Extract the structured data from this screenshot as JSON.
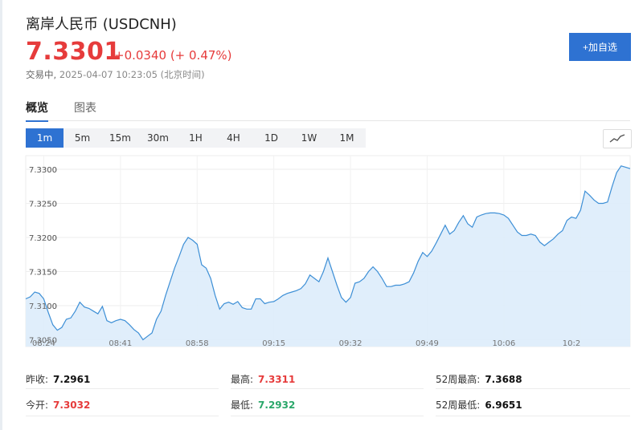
{
  "header": {
    "title": "离岸人民币 (USDCNH)",
    "price": "7.3301",
    "change": "+0.0340 (+ 0.47%)",
    "status": "交易中",
    "timestamp": "2025-04-07 10:23:05 (北京时间)",
    "add_button": "+加自选"
  },
  "tabs": [
    "概览",
    "图表"
  ],
  "periods": [
    "1m",
    "5m",
    "15m",
    "30m",
    "1H",
    "4H",
    "1D",
    "1W",
    "1M"
  ],
  "active_period": "1m",
  "colors": {
    "up": "#e63b3b",
    "down": "#2aa76a",
    "accent": "#2e72d2",
    "line": "#3d8fd6",
    "fill": "#ddecfb"
  },
  "stats": {
    "prev_close": {
      "label": "昨收:",
      "value": "7.2961"
    },
    "open": {
      "label": "今开:",
      "value": "7.3032"
    },
    "high": {
      "label": "最高:",
      "value": "7.3311"
    },
    "low": {
      "label": "最低:",
      "value": "7.2932"
    },
    "high_52w": {
      "label": "52周最高:",
      "value": "7.3688"
    },
    "low_52w": {
      "label": "52周最低:",
      "value": "6.9651"
    }
  },
  "chart_data": {
    "type": "area",
    "x_ticks": [
      "08:24",
      "08:41",
      "08:58",
      "09:15",
      "09:32",
      "09:49",
      "10:06",
      "10:2"
    ],
    "y_ticks": [
      "7.3050",
      "7.3100",
      "7.3150",
      "7.3200",
      "7.3250",
      "7.3300"
    ],
    "ylim": [
      7.304,
      7.332
    ],
    "xlim": [
      0,
      124
    ],
    "grid": true,
    "points": [
      [
        0,
        7.311
      ],
      [
        1,
        7.3113
      ],
      [
        2,
        7.312
      ],
      [
        3,
        7.3118
      ],
      [
        4,
        7.311
      ],
      [
        5,
        7.309
      ],
      [
        6,
        7.3072
      ],
      [
        7,
        7.3064
      ],
      [
        8,
        7.3068
      ],
      [
        9,
        7.308
      ],
      [
        10,
        7.3082
      ],
      [
        11,
        7.3092
      ],
      [
        12,
        7.3105
      ],
      [
        13,
        7.3098
      ],
      [
        14,
        7.3096
      ],
      [
        15,
        7.3092
      ],
      [
        16,
        7.3088
      ],
      [
        17,
        7.3099
      ],
      [
        18,
        7.3078
      ],
      [
        19,
        7.3075
      ],
      [
        20,
        7.3078
      ],
      [
        21,
        7.308
      ],
      [
        22,
        7.3078
      ],
      [
        23,
        7.3072
      ],
      [
        24,
        7.3065
      ],
      [
        25,
        7.306
      ],
      [
        26,
        7.305
      ],
      [
        27,
        7.3055
      ],
      [
        28,
        7.306
      ],
      [
        29,
        7.308
      ],
      [
        30,
        7.3092
      ],
      [
        31,
        7.3115
      ],
      [
        32,
        7.3135
      ],
      [
        33,
        7.3155
      ],
      [
        34,
        7.3172
      ],
      [
        35,
        7.319
      ],
      [
        36,
        7.32
      ],
      [
        37,
        7.3196
      ],
      [
        38,
        7.319
      ],
      [
        39,
        7.316
      ],
      [
        40,
        7.3155
      ],
      [
        41,
        7.314
      ],
      [
        42,
        7.3115
      ],
      [
        43,
        7.3095
      ],
      [
        44,
        7.3103
      ],
      [
        45,
        7.3105
      ],
      [
        46,
        7.3102
      ],
      [
        47,
        7.3106
      ],
      [
        48,
        7.3097
      ],
      [
        49,
        7.3095
      ],
      [
        50,
        7.3095
      ],
      [
        51,
        7.311
      ],
      [
        52,
        7.311
      ],
      [
        53,
        7.3103
      ],
      [
        54,
        7.3105
      ],
      [
        55,
        7.3106
      ],
      [
        56,
        7.311
      ],
      [
        57,
        7.3115
      ],
      [
        58,
        7.3118
      ],
      [
        59,
        7.312
      ],
      [
        60,
        7.3122
      ],
      [
        61,
        7.3125
      ],
      [
        62,
        7.3132
      ],
      [
        63,
        7.3145
      ],
      [
        64,
        7.314
      ],
      [
        65,
        7.3135
      ],
      [
        66,
        7.315
      ],
      [
        67,
        7.317
      ],
      [
        68,
        7.315
      ],
      [
        69,
        7.313
      ],
      [
        70,
        7.3112
      ],
      [
        71,
        7.3105
      ],
      [
        72,
        7.3112
      ],
      [
        73,
        7.3133
      ],
      [
        74,
        7.3135
      ],
      [
        75,
        7.314
      ],
      [
        76,
        7.315
      ],
      [
        77,
        7.3157
      ],
      [
        78,
        7.315
      ],
      [
        79,
        7.314
      ],
      [
        80,
        7.3128
      ],
      [
        81,
        7.3128
      ],
      [
        82,
        7.313
      ],
      [
        83,
        7.313
      ],
      [
        84,
        7.3132
      ],
      [
        85,
        7.3135
      ],
      [
        86,
        7.3148
      ],
      [
        87,
        7.3165
      ],
      [
        88,
        7.3178
      ],
      [
        89,
        7.3172
      ],
      [
        90,
        7.318
      ],
      [
        91,
        7.3192
      ],
      [
        92,
        7.3205
      ],
      [
        93,
        7.3218
      ],
      [
        94,
        7.3205
      ],
      [
        95,
        7.321
      ],
      [
        96,
        7.3222
      ],
      [
        97,
        7.3232
      ],
      [
        98,
        7.322
      ],
      [
        99,
        7.3215
      ],
      [
        100,
        7.323
      ],
      [
        101,
        7.3233
      ],
      [
        102,
        7.3235
      ],
      [
        103,
        7.3236
      ],
      [
        104,
        7.3236
      ],
      [
        105,
        7.3235
      ],
      [
        106,
        7.3233
      ],
      [
        107,
        7.3228
      ],
      [
        108,
        7.3218
      ],
      [
        109,
        7.3208
      ],
      [
        110,
        7.3203
      ],
      [
        111,
        7.3203
      ],
      [
        112,
        7.3205
      ],
      [
        113,
        7.3203
      ],
      [
        114,
        7.3193
      ],
      [
        115,
        7.3188
      ],
      [
        116,
        7.3193
      ],
      [
        117,
        7.3198
      ],
      [
        118,
        7.3205
      ],
      [
        119,
        7.321
      ],
      [
        120,
        7.3225
      ],
      [
        121,
        7.323
      ],
      [
        122,
        7.3228
      ],
      [
        123,
        7.324
      ],
      [
        124,
        7.3268
      ],
      [
        125,
        7.3262
      ],
      [
        126,
        7.3255
      ],
      [
        127,
        7.325
      ],
      [
        128,
        7.325
      ],
      [
        129,
        7.3252
      ],
      [
        130,
        7.3275
      ],
      [
        131,
        7.3295
      ],
      [
        132,
        7.3305
      ],
      [
        133,
        7.3303
      ],
      [
        134,
        7.3301
      ]
    ]
  }
}
